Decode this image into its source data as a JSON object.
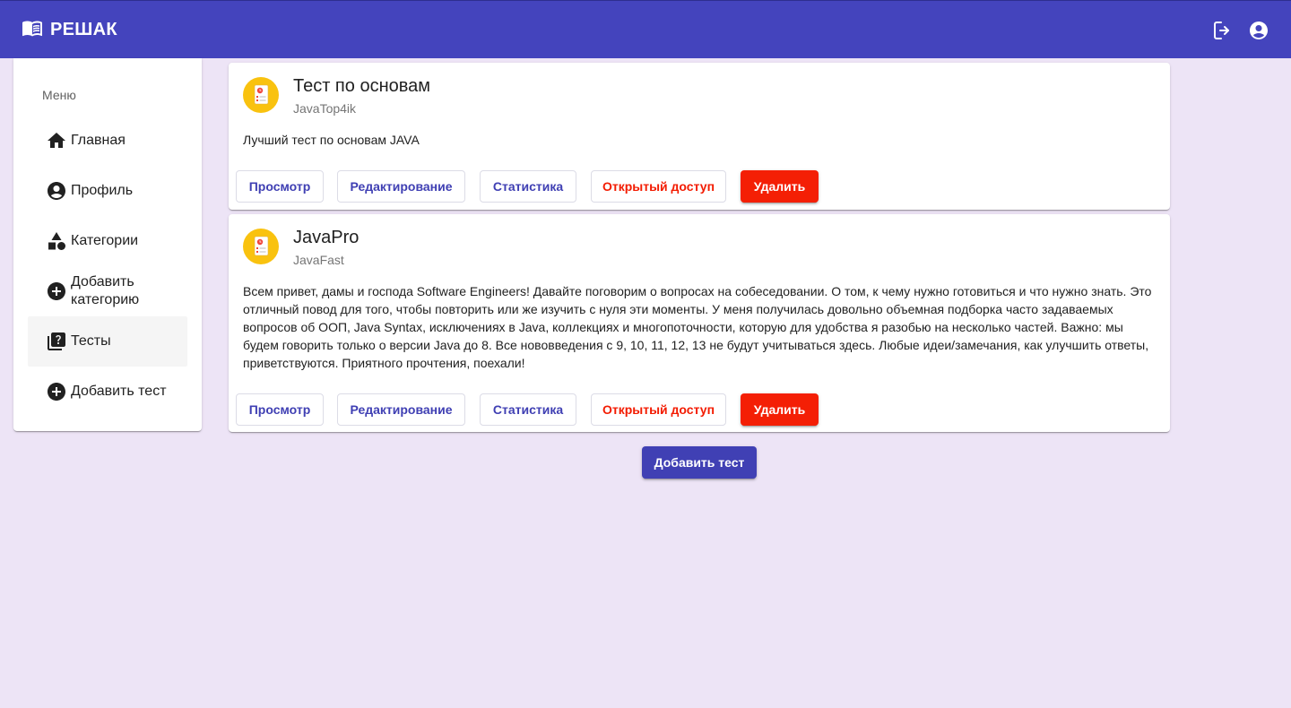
{
  "header": {
    "brand": "РЕШАК",
    "brand_icon": "open-book-icon",
    "logout_icon": "logout-icon",
    "account_icon": "account-circle-icon",
    "color": "#4444bd"
  },
  "sidebar": {
    "title": "Меню",
    "items": [
      {
        "label": "Главная",
        "icon": "home-icon",
        "active": false
      },
      {
        "label": "Профиль",
        "icon": "account-circle-icon",
        "active": false
      },
      {
        "label": "Категории",
        "icon": "category-icon",
        "active": false
      },
      {
        "label": "Добавить категорию",
        "icon": "add-circle-icon",
        "active": false
      },
      {
        "label": "Тесты",
        "icon": "quiz-icon",
        "active": true
      },
      {
        "label": "Добавить тест",
        "icon": "add-circle-icon",
        "active": false
      }
    ]
  },
  "tests": [
    {
      "title": "Тест по основам",
      "subtitle": "JavaTop4ik",
      "description": "Лучший тест по основам JAVA",
      "actions": {
        "view": "Просмотр",
        "edit": "Редактирование",
        "stats": "Статистика",
        "public": "Открытый доступ",
        "delete": "Удалить"
      }
    },
    {
      "title": "JavaPro",
      "subtitle": "JavaFast",
      "description": "Всем привет, дамы и господа Software Engineers! Давайте поговорим о вопросах на собеседовании. О том, к чему нужно готовиться и что нужно знать. Это отличный повод для того, чтобы повторить или же изучить с нуля эти моменты. У меня получилась довольно объемная подборка часто задаваемых вопросов об ООП, Java Syntax, исключениях в Java, коллекциях и многопоточности, которую для удобства я разобью на несколько частей. Важно: мы будем говорить только о версии Java до 8. Все нововведения с 9, 10, 11, 12, 13 не будут учитываться здесь. Любые идеи/замечания, как улучшить ответы, приветствуются. Приятного прочтения, поехали!",
      "actions": {
        "view": "Просмотр",
        "edit": "Редактирование",
        "stats": "Статистика",
        "public": "Открытый доступ",
        "delete": "Удалить"
      }
    }
  ],
  "add_test_button": "Добавить тест",
  "colors": {
    "primary": "#4040b4",
    "danger": "#f41f05",
    "background": "#ede4f6"
  }
}
